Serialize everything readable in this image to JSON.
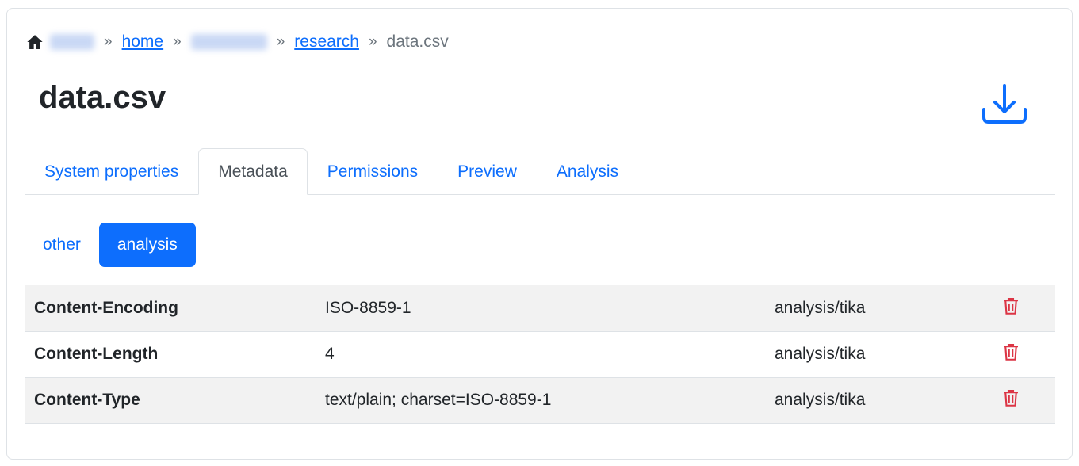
{
  "breadcrumb": {
    "items": [
      {
        "label": "home"
      },
      {
        "label": "research"
      }
    ],
    "current": "data.csv",
    "separator": "»"
  },
  "page": {
    "title": "data.csv"
  },
  "tabs": [
    {
      "label": "System properties",
      "active": false
    },
    {
      "label": "Metadata",
      "active": true
    },
    {
      "label": "Permissions",
      "active": false
    },
    {
      "label": "Preview",
      "active": false
    },
    {
      "label": "Analysis",
      "active": false
    }
  ],
  "pills": [
    {
      "label": "other",
      "active": false
    },
    {
      "label": "analysis",
      "active": true
    }
  ],
  "metadata": {
    "rows": [
      {
        "key": "Content-Encoding",
        "value": "ISO-8859-1",
        "unit": "analysis/tika"
      },
      {
        "key": "Content-Length",
        "value": "4",
        "unit": "analysis/tika"
      },
      {
        "key": "Content-Type",
        "value": "text/plain; charset=ISO-8859-1",
        "unit": "analysis/tika"
      }
    ]
  },
  "colors": {
    "primary": "#0d6efd",
    "danger": "#dc3545",
    "muted": "#6c757d",
    "stripe": "#f2f2f2"
  },
  "icons": {
    "home": "home-icon",
    "download": "download-icon",
    "delete": "trash-icon"
  }
}
